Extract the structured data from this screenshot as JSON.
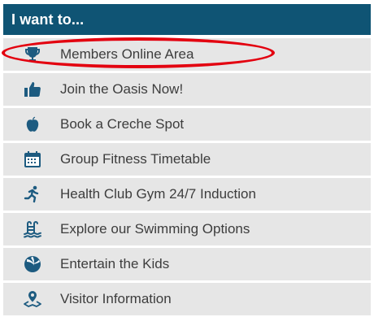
{
  "panel": {
    "title": "I want to...",
    "items": [
      {
        "label": "Members Online Area",
        "icon": "trophy-icon"
      },
      {
        "label": "Join the Oasis Now!",
        "icon": "thumbs-up-icon"
      },
      {
        "label": "Book a Creche Spot",
        "icon": "apple-icon"
      },
      {
        "label": "Group Fitness Timetable",
        "icon": "calendar-icon"
      },
      {
        "label": "Health Club Gym 24/7 Induction",
        "icon": "running-person-icon"
      },
      {
        "label": "Explore our Swimming Options",
        "icon": "pool-ladder-icon"
      },
      {
        "label": "Entertain the Kids",
        "icon": "beach-ball-icon"
      },
      {
        "label": "Visitor Information",
        "icon": "map-pin-icon"
      }
    ]
  },
  "colors": {
    "header_bg": "#0f5474",
    "item_bg": "#e6e6e6",
    "icon": "#1d5b80",
    "text": "#3d3d3d",
    "highlight": "#e3000f"
  }
}
